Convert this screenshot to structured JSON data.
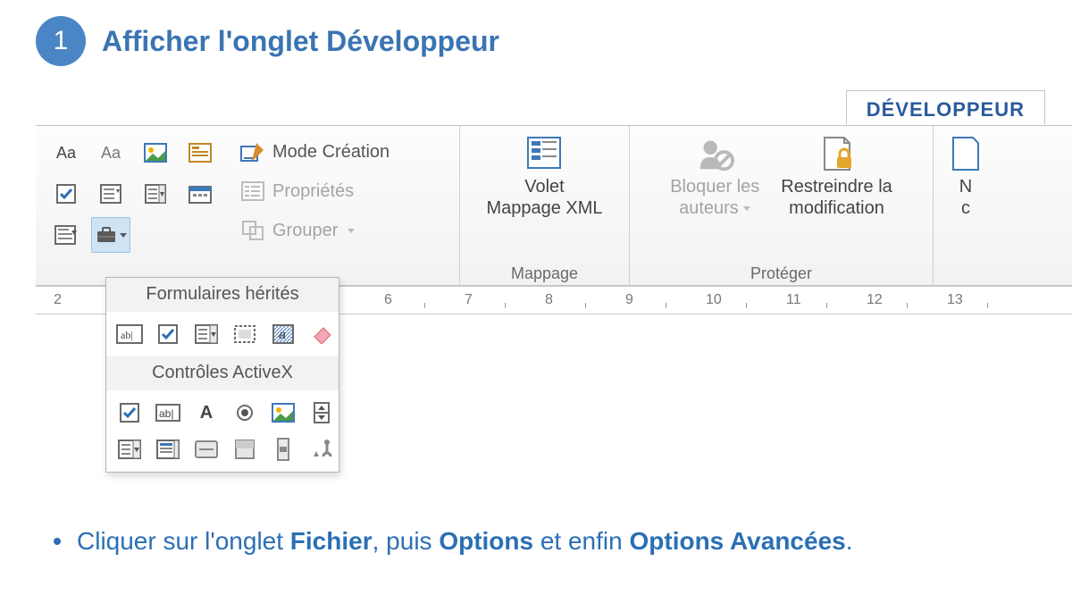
{
  "step": {
    "number": "1",
    "title": "Afficher l'onglet Développeur"
  },
  "tab": {
    "label": "DÉVELOPPEUR"
  },
  "controls_group": {
    "mode_creation": "Mode Création",
    "properties": "Propriétés",
    "group": "Grouper"
  },
  "mapping_group": {
    "button_line1": "Volet",
    "button_line2": "Mappage XML",
    "label": "Mappage"
  },
  "protect_group": {
    "block_line1": "Bloquer les",
    "block_line2": "auteurs",
    "restrict_line1": "Restreindre la",
    "restrict_line2": "modification",
    "label": "Protéger"
  },
  "clipped": {
    "line1": "N",
    "line2": "c"
  },
  "palette": {
    "legacy_header": "Formulaires hérités",
    "activex_header": "Contrôles ActiveX"
  },
  "ruler_left": "2",
  "ruler_numbers": [
    "6",
    "7",
    "8",
    "9",
    "10",
    "11",
    "12",
    "13"
  ],
  "instruction": {
    "pre": "Cliquer sur l'onglet ",
    "b1": "Fichier",
    "mid1": ", puis ",
    "b2": "Options",
    "mid2": " et enfin ",
    "b3": "Options Avancées",
    "post": "."
  }
}
